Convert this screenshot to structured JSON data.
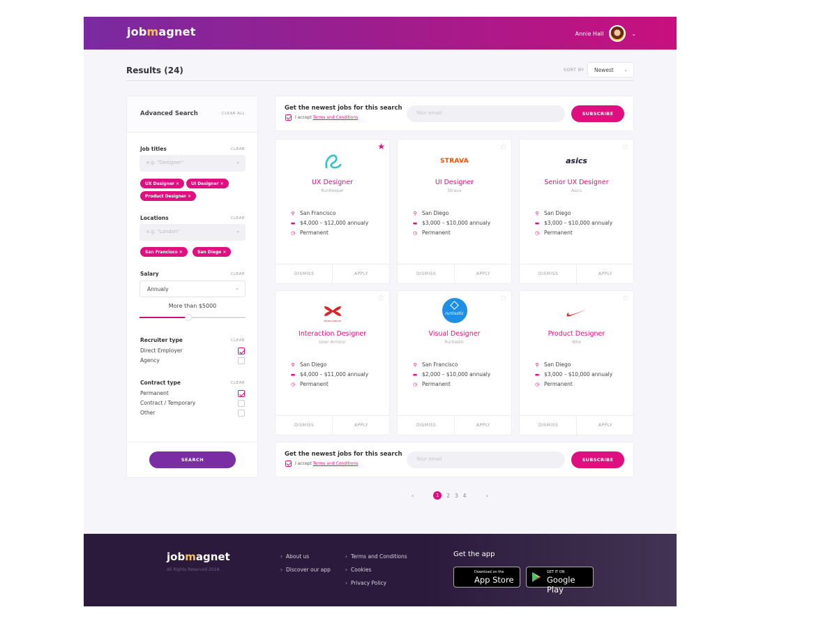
{
  "header": {
    "logo_pre": "job",
    "logo_m": "m",
    "logo_post": "agnet",
    "user_name": "Annie Hall"
  },
  "results": {
    "title": "Results (24)",
    "sort_label": "SORT BY",
    "sort_value": "Newest"
  },
  "sidebar": {
    "title": "Advanced Search",
    "clear_all": "CLEAR ALL",
    "clear": "CLEAR",
    "job_titles": {
      "label": "Job titles",
      "placeholder": "e.g. \"Designer\"",
      "chips": [
        "UX Designer",
        "UI Designer",
        "Product Designer"
      ]
    },
    "locations": {
      "label": "Locations",
      "placeholder": "e.g. \"London\"",
      "chips": [
        "San Francisco",
        "San Diego"
      ]
    },
    "salary": {
      "label": "Salary",
      "period": "Annualy",
      "value_text": "More than $5000",
      "slider_fraction": 0.46
    },
    "recruiter": {
      "label": "Recruiter type",
      "options": [
        {
          "label": "Direct Employer",
          "checked": true
        },
        {
          "label": "Agency",
          "checked": false
        }
      ]
    },
    "contract": {
      "label": "Contract type",
      "options": [
        {
          "label": "Permanent",
          "checked": true
        },
        {
          "label": "Contract / Temporary",
          "checked": false
        },
        {
          "label": "Other",
          "checked": false
        }
      ]
    },
    "search_button": "SEARCH"
  },
  "newsletter": {
    "title": "Get the newest jobs for this search",
    "accept_prefix": "I accept",
    "accept_link": "Terms and Conditions",
    "email_placeholder": "Your email",
    "subscribe": "SUBSCRIBE"
  },
  "jobs": [
    {
      "title": "UX Designer",
      "company": "RunKeeper",
      "location": "San Francisco",
      "salary": "$4,000 – $12,000 annualy",
      "type": "Permanent",
      "favorite": true,
      "logo": "runkeeper-logo"
    },
    {
      "title": "UI Designer",
      "company": "Strava",
      "location": "San Diego",
      "salary": "$3,000 – $10,000 annualy",
      "type": "Permanent",
      "favorite": false,
      "logo": "strava-logo"
    },
    {
      "title": "Senior UX Designer",
      "company": "Asics",
      "location": "San Diego",
      "salary": "$3,000 – $10,000 annualy",
      "type": "Permanent",
      "favorite": false,
      "logo": "asics-logo"
    },
    {
      "title": "Interaction Designer",
      "company": "Uner Armour",
      "location": "San Diego",
      "salary": "$4,000 – $11,000 annualy",
      "type": "Permanent",
      "favorite": false,
      "logo": "under-armour-logo"
    },
    {
      "title": "Visual Designer",
      "company": "Runtastic",
      "location": "San Francisco",
      "salary": "$2,000 – $10,000 annualy",
      "type": "Permanent",
      "favorite": false,
      "logo": "runtastic-logo"
    },
    {
      "title": "Product Designer",
      "company": "Nike",
      "location": "San Diego",
      "salary": "$3,000 – $10,000 annualy",
      "type": "Permanent",
      "favorite": false,
      "logo": "nike-logo"
    }
  ],
  "card_actions": {
    "dismiss": "DISMISS",
    "apply": "APPLY"
  },
  "logo_text": {
    "strava": "STRAVA",
    "asics": "asics",
    "under_armour": "UNDER ARMOUR",
    "runtastic": "runtastic"
  },
  "pagination": {
    "pages": [
      "1",
      "2",
      "3",
      "4"
    ],
    "current": "1"
  },
  "footer": {
    "logo_pre": "job",
    "logo_m": "m",
    "logo_post": "agnet",
    "rights": "All Rights Reserved 2018",
    "links_col1": [
      "About us",
      "Discover our app"
    ],
    "links_col2": [
      "Terms and Conditions",
      "Cookies",
      "Privacy Policy"
    ],
    "app_title": "Get the app",
    "app_store_small": "Download on the",
    "app_store_big": "App Store",
    "google_small": "GET IT ON",
    "google_big": "Google Play"
  },
  "colors": {
    "accent": "#df0f7f",
    "purple": "#7b2ea4",
    "footer_bg": "#2b1a3c"
  }
}
